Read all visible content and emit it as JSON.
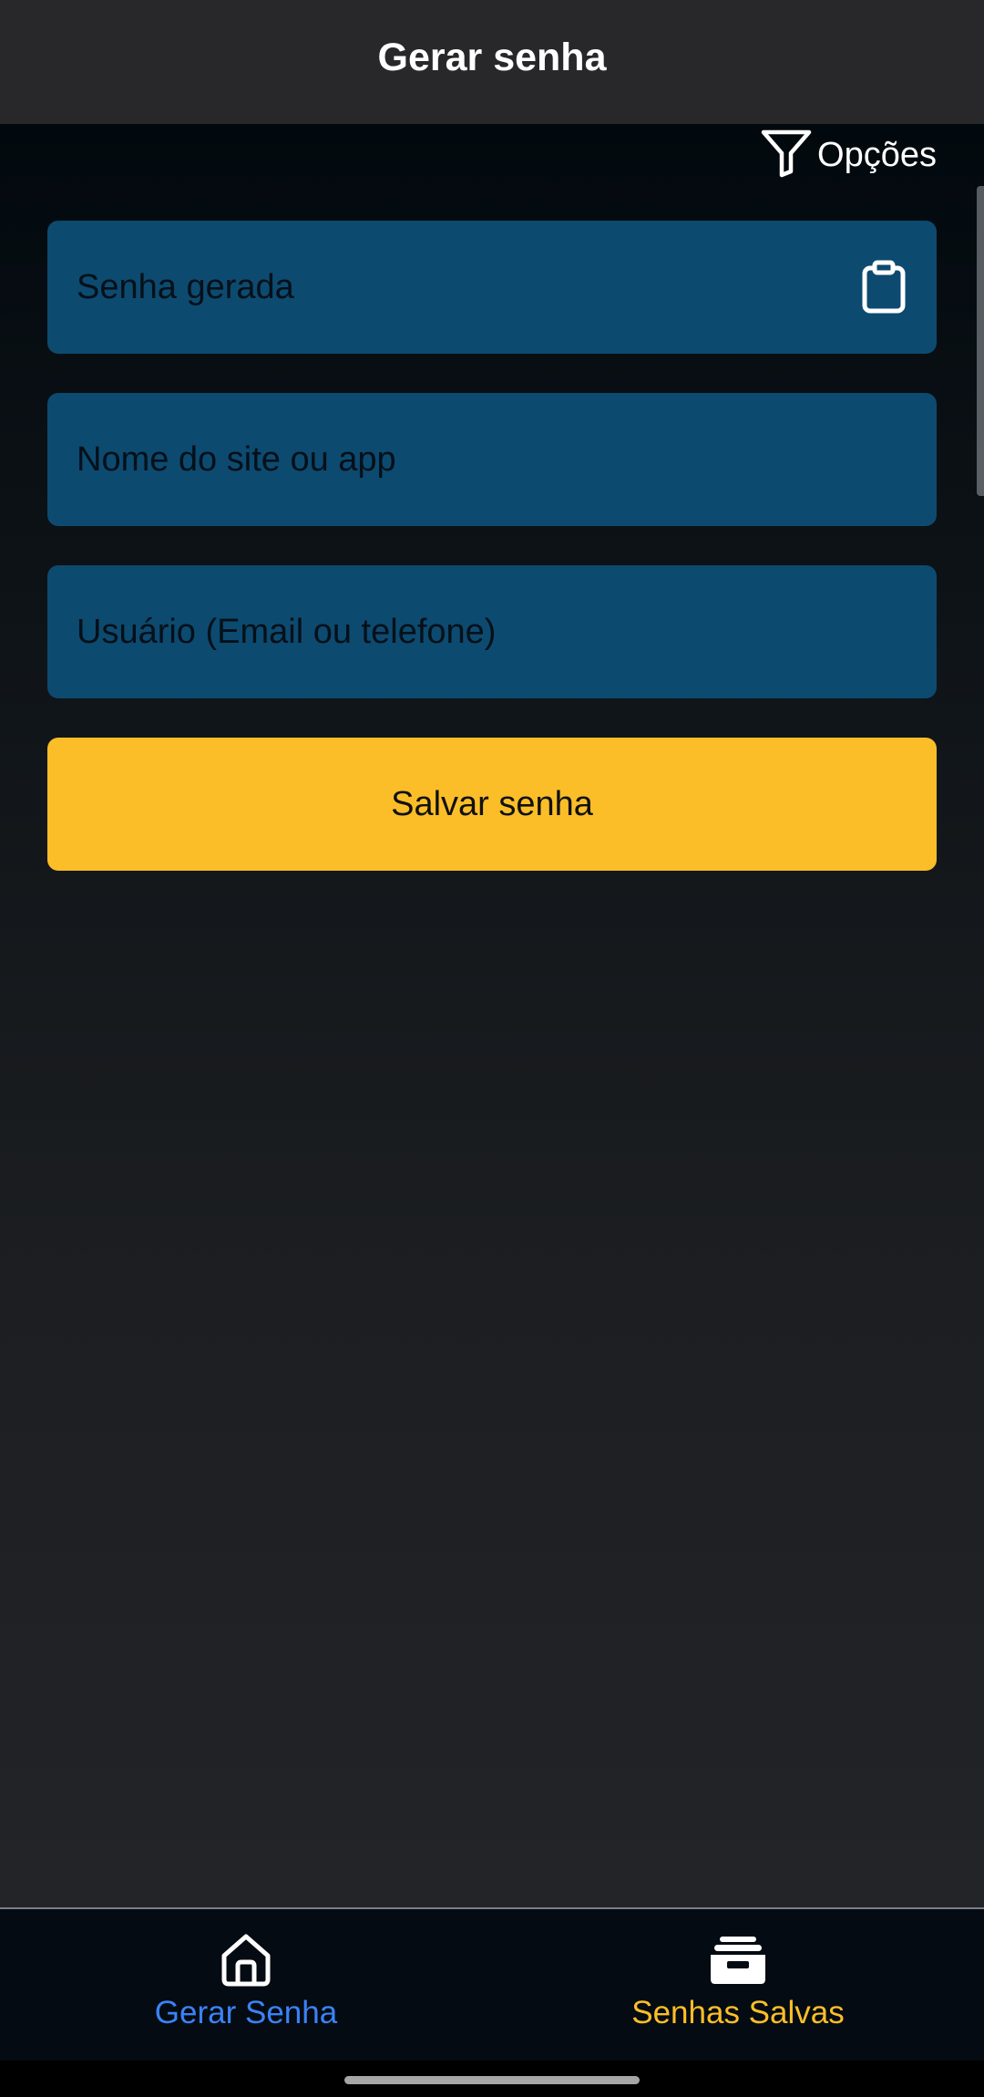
{
  "header": {
    "title": "Gerar senha"
  },
  "options": {
    "label": "Opções",
    "icon": "filter-icon"
  },
  "form": {
    "generated_password": {
      "placeholder": "Senha gerada",
      "value": "",
      "icon": "clipboard-icon"
    },
    "site_name": {
      "placeholder": "Nome do site ou app",
      "value": ""
    },
    "user": {
      "placeholder": "Usuário (Email ou telefone)",
      "value": ""
    },
    "save_label": "Salvar senha"
  },
  "bottom_nav": {
    "items": [
      {
        "label": "Gerar Senha",
        "icon": "home-icon",
        "active": true
      },
      {
        "label": "Senhas Salvas",
        "icon": "archive-box-icon",
        "active": false
      }
    ]
  },
  "colors": {
    "header_bg": "#28282b",
    "field_bg": "#0d4a70",
    "button_bg": "#fbbe28",
    "nav_active": "#3b82f6",
    "nav_inactive": "#fbbe28"
  }
}
